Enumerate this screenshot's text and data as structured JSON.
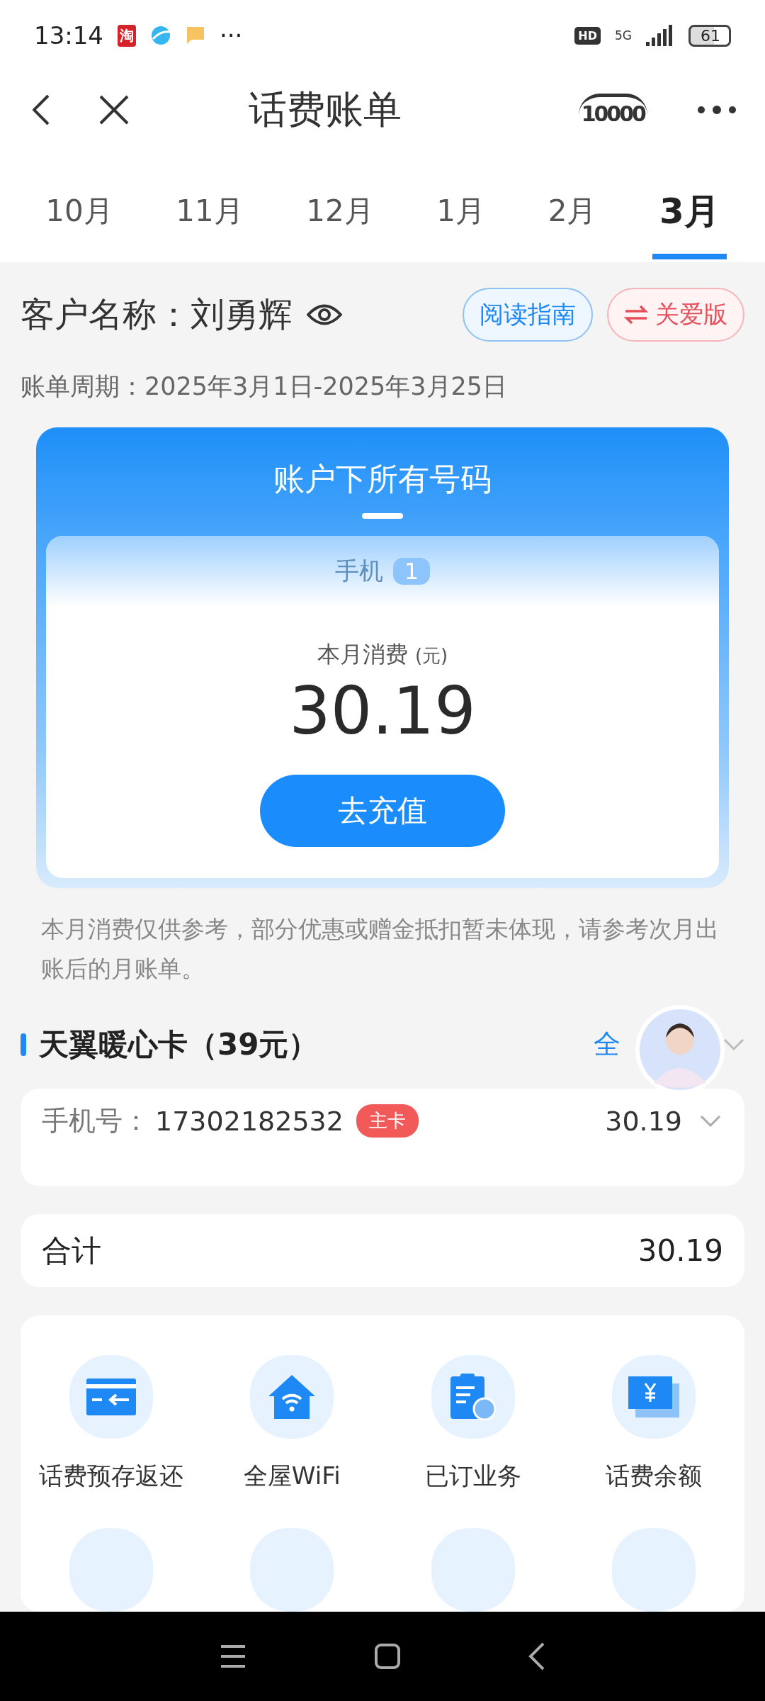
{
  "status_bar": {
    "time": "13:14",
    "app_badge": "淘",
    "more": "···",
    "hd": "HD",
    "network": "5G",
    "battery": "61"
  },
  "header": {
    "title": "话费账单",
    "service_logo": "10000"
  },
  "tabs": [
    {
      "label": "10月",
      "selected": false
    },
    {
      "label": "11月",
      "selected": false
    },
    {
      "label": "12月",
      "selected": false
    },
    {
      "label": "1月",
      "selected": false
    },
    {
      "label": "2月",
      "selected": false
    },
    {
      "label": "3月",
      "selected": true
    }
  ],
  "customer": {
    "label": "客户名称：刘勇辉",
    "guide_button": "阅读指南",
    "care_button": "关爱版"
  },
  "period": "账单周期：2025年3月1日-2025年3月25日",
  "summary_card": {
    "title": "账户下所有号码",
    "category": "手机",
    "count": "1",
    "spend_label": "本月消费",
    "unit": "(元)",
    "amount": "30.19",
    "recharge_button": "去充值"
  },
  "note": "本月消费仅供参考，部分优惠或赠金抵扣暂未体现，请参考次月出账后的月账单。",
  "plan": {
    "title": "天翼暖心卡（39元）",
    "action": "全"
  },
  "lines": [
    {
      "label": "手机号：",
      "number": "17302182532",
      "tag": "主卡",
      "amount": "30.19",
      "expanded": false
    }
  ],
  "total": {
    "label": "合计",
    "amount": "30.19"
  },
  "services": [
    {
      "kind": "card",
      "label": "话费预存返还"
    },
    {
      "kind": "wifi",
      "label": "全屋WiFi"
    },
    {
      "kind": "clipboard",
      "label": "已订业务"
    },
    {
      "kind": "balance",
      "label": "话费余额"
    }
  ]
}
